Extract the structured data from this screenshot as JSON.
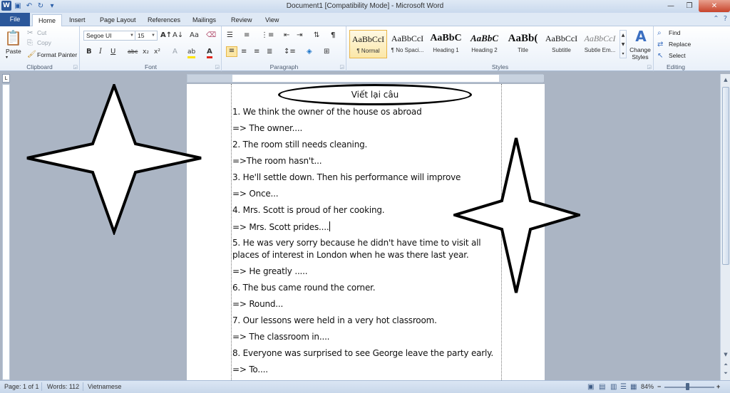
{
  "window": {
    "title": "Document1 [Compatibility Mode] - Microsoft Word",
    "word_logo": "W"
  },
  "tabs": [
    {
      "label": "File"
    },
    {
      "label": "Home"
    },
    {
      "label": "Insert"
    },
    {
      "label": "Page Layout"
    },
    {
      "label": "References"
    },
    {
      "label": "Mailings"
    },
    {
      "label": "Review"
    },
    {
      "label": "View"
    }
  ],
  "ribbon": {
    "clipboard": {
      "group": "Clipboard",
      "paste": "Paste",
      "cut": "Cut",
      "copy": "Copy",
      "format_painter": "Format Painter"
    },
    "font": {
      "group": "Font",
      "font_name": "Segoe UI",
      "font_size": "15"
    },
    "paragraph": {
      "group": "Paragraph"
    },
    "styles": {
      "group": "Styles",
      "items": [
        {
          "sample": "AaBbCcI",
          "name": "¶ Normal"
        },
        {
          "sample": "AaBbCcI",
          "name": "¶ No Spaci..."
        },
        {
          "sample": "AaBbC",
          "name": "Heading 1"
        },
        {
          "sample": "AaBbC",
          "name": "Heading 2"
        },
        {
          "sample": "AaBb(",
          "name": "Title"
        },
        {
          "sample": "AaBbCcI",
          "name": "Subtitle"
        },
        {
          "sample": "AaBbCcI",
          "name": "Subtle Em..."
        }
      ],
      "change_styles": "Change Styles"
    },
    "editing": {
      "group": "Editing",
      "find": "Find",
      "replace": "Replace",
      "select": "Select"
    }
  },
  "document": {
    "heading": "Viết lại câu",
    "lines": [
      "1. We think the owner of the house os abroad",
      "=> The owner....",
      "2. The room still needs cleaning.",
      "=>The room hasn't...",
      "3. He'll settle down. Then his performance will improve",
      "=> Once...",
      "4. Mrs. Scott is proud of her cooking.",
      "=> Mrs. Scott prides....",
      "5. He was very sorry because he didn't have time to visit all places of interest in London when he was there last year.",
      "=> He greatly .....",
      "6. The bus came round the corner.",
      "=> Round...",
      "7. Our lessons were held in a very hot classroom.",
      "=> The classroom in....",
      "8. Everyone was surprised to see George leave the party early.",
      "=> To...."
    ]
  },
  "status": {
    "page": "Page: 1 of 1",
    "words": "Words: 112",
    "language": "Vietnamese",
    "zoom": "84%"
  }
}
